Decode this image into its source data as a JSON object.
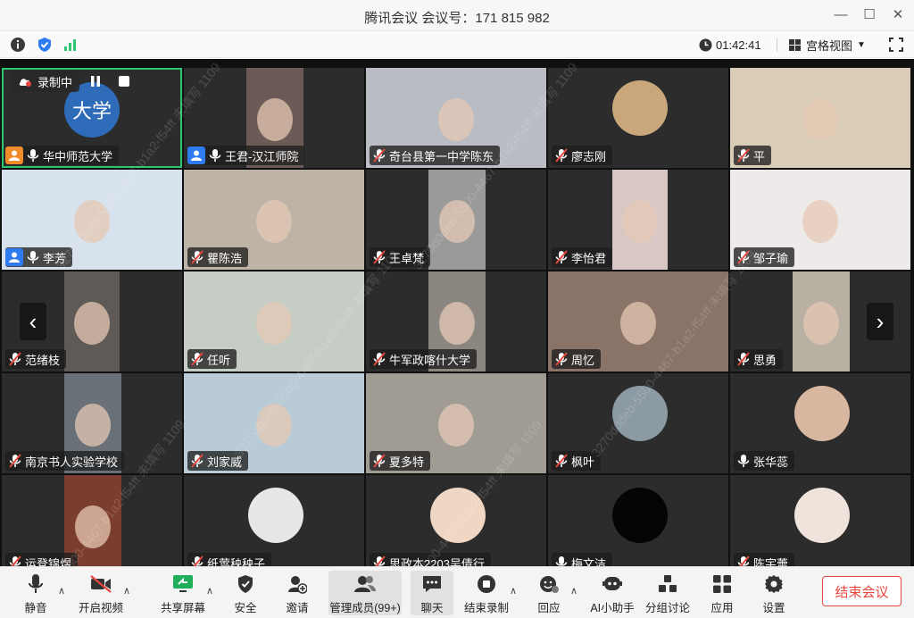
{
  "window": {
    "title": "腾讯会议 会议号：171 815 982",
    "minimize": "—",
    "maximize": "☐",
    "close": "✕"
  },
  "infobar": {
    "timer": "01:42:41",
    "view_label": "宫格视图"
  },
  "recording": {
    "label": "录制中"
  },
  "watermark": "3270d0deb-5500-4467-b1a2-f54ff 未填写 1109",
  "tiles": [
    {
      "name": "华中师范大学",
      "badge": "host",
      "muted": false,
      "avatar_text": "大学",
      "avatar_color": "#2e6bb8"
    },
    {
      "name": "王君-汉江师院",
      "badge": "cohost",
      "muted": false
    },
    {
      "name": "奇台县第一中学陈东",
      "muted": true
    },
    {
      "name": "廖志刚",
      "muted": true
    },
    {
      "name": "平",
      "muted": true
    },
    {
      "name": "李芳",
      "badge": "cohost",
      "muted": false
    },
    {
      "name": "瞿陈浩",
      "muted": true
    },
    {
      "name": "王卓梵",
      "muted": true
    },
    {
      "name": "李怡君",
      "muted": true
    },
    {
      "name": "邹子瑜",
      "muted": true
    },
    {
      "name": "范绪枝",
      "muted": true
    },
    {
      "name": "任听",
      "muted": true
    },
    {
      "name": "牛军政喀什大学",
      "muted": true
    },
    {
      "name": "周忆",
      "muted": true
    },
    {
      "name": "思勇",
      "muted": true
    },
    {
      "name": "南京书人实验学校",
      "muted": true
    },
    {
      "name": "刘家威",
      "muted": true
    },
    {
      "name": "夏多特",
      "muted": true
    },
    {
      "name": "枫叶",
      "muted": true
    },
    {
      "name": "张华蕊",
      "muted": false
    },
    {
      "name": "运登锦煜",
      "muted": true
    },
    {
      "name": "纸莺秧秧子",
      "muted": true
    },
    {
      "name": "思政本2203吴倩行",
      "muted": true
    },
    {
      "name": "梅文洁",
      "muted": false
    },
    {
      "name": "陈宇蕾",
      "muted": true
    }
  ],
  "toolbar": {
    "mute": "静音",
    "video": "开启视频",
    "share": "共享屏幕",
    "security": "安全",
    "invite": "邀请",
    "members": "管理成员(99+)",
    "chat": "聊天",
    "end_record": "结束录制",
    "reply": "回应",
    "ai": "AI小助手",
    "breakout": "分组讨论",
    "apps": "应用",
    "settings": "设置",
    "end_meeting": "结束会议"
  },
  "colors": {
    "accent_green": "#2fc46f",
    "end_red": "#e5473f",
    "grid_bg": "#2c2c2c"
  }
}
